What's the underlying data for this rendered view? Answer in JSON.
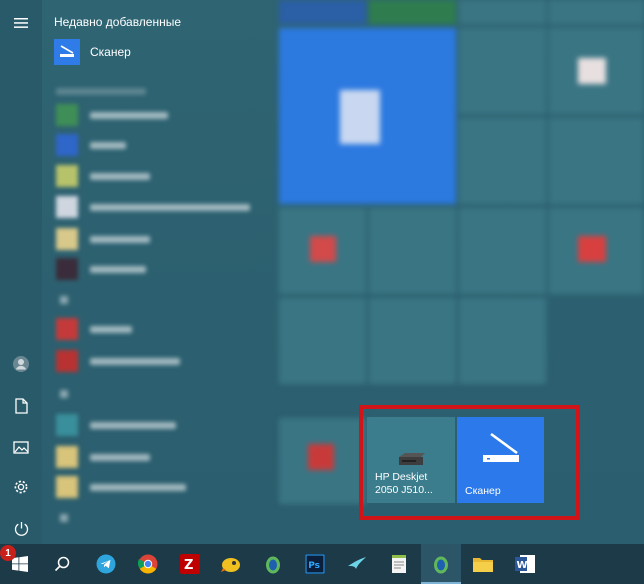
{
  "start_menu": {
    "recent_header": "Недавно добавленные",
    "recent_item_label": "Сканер"
  },
  "tiles": {
    "hp_label": "HP Deskjet 2050 J510...",
    "scanner_label": "Сканер"
  },
  "taskbar": {
    "notification_count": "1"
  },
  "colors": {
    "accent": "#2b79ea",
    "selection_border": "#d01418",
    "taskbar": "#1c3a47"
  },
  "icons": [
    "hamburger-icon",
    "scanner-icon",
    "user-icon",
    "document-icon",
    "pictures-icon",
    "settings-icon",
    "power-icon",
    "windows-icon",
    "search-icon",
    "telegram-icon",
    "chrome-icon",
    "filezilla-icon",
    "photoshop-icon",
    "word-icon",
    "file-explorer-icon"
  ]
}
